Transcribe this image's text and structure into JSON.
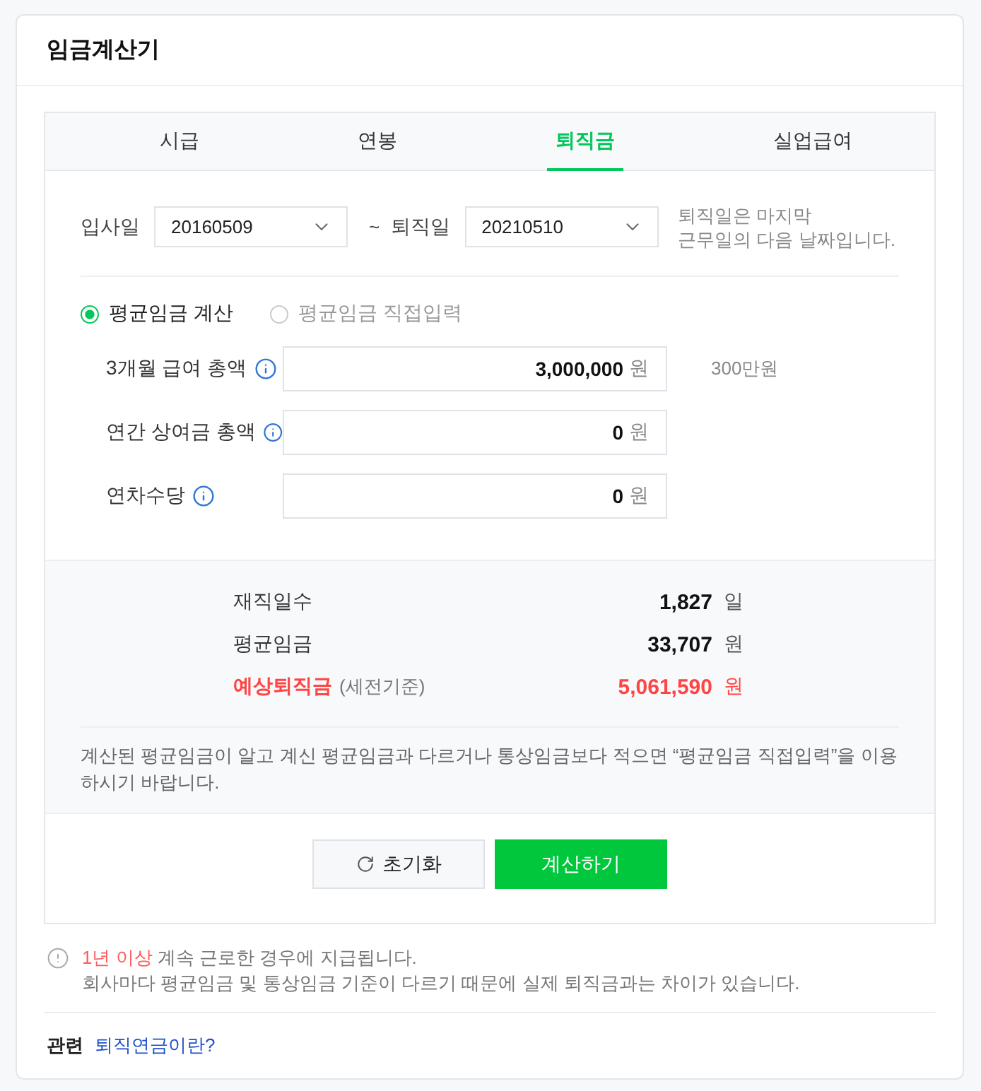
{
  "window": {
    "title": "임금계산기"
  },
  "tabs": [
    {
      "label": "시급",
      "selected": false
    },
    {
      "label": "연봉",
      "selected": false
    },
    {
      "label": "퇴직금",
      "selected": true
    },
    {
      "label": "실업급여",
      "selected": false
    }
  ],
  "dates": {
    "start": {
      "label": "입사일",
      "value": "20160509"
    },
    "separator": "~",
    "end": {
      "label": "퇴직일",
      "value": "20210510"
    },
    "hint_lines": [
      "퇴직일은 마지막",
      "근무일의 다음 날짜입니다."
    ]
  },
  "calc_modes": [
    {
      "label": "평균임금 계산",
      "selected": true
    },
    {
      "label": "평균임금 직접입력",
      "selected": false
    }
  ],
  "fields": [
    {
      "label": "3개월 급여 총액",
      "value": "3,000,000",
      "unit": "원",
      "note": "300만원"
    },
    {
      "label": "연간 상여금 총액",
      "value": "0",
      "unit": "원"
    },
    {
      "label": "연차수당",
      "value": "0",
      "unit": "원"
    }
  ],
  "results": [
    {
      "kind": "normal",
      "label": "재직일수",
      "value": "1,827",
      "unit": "일"
    },
    {
      "kind": "normal",
      "label": "평균임금",
      "value": "33,707",
      "unit": "원"
    },
    {
      "kind": "highlight",
      "label": "예상퇴직금",
      "sublabel": "(세전기준)",
      "value": "5,061,590",
      "unit": "원"
    }
  ],
  "result_note": "계산된 평균임금이 알고 계신 평균임금과 다르거나 통상임금보다 적으면 “평균임금 직접입력”을 이용하시기 바랍니다.",
  "buttons": [
    {
      "kind": "reset",
      "label": "초기화"
    },
    {
      "kind": "primary",
      "label": "계산하기"
    }
  ],
  "notice": {
    "lines": [
      {
        "highlight": "1년 이상",
        "text": "계속 근로한 경우에 지급됩니다."
      },
      {
        "text": "회사마다 평균임금 및 통상임금 기준이 다르기 때문에 실제 퇴직금과는 차이가 있습니다."
      }
    ]
  },
  "related": {
    "label": "관련",
    "links": [
      "퇴직연금이란?"
    ]
  }
}
